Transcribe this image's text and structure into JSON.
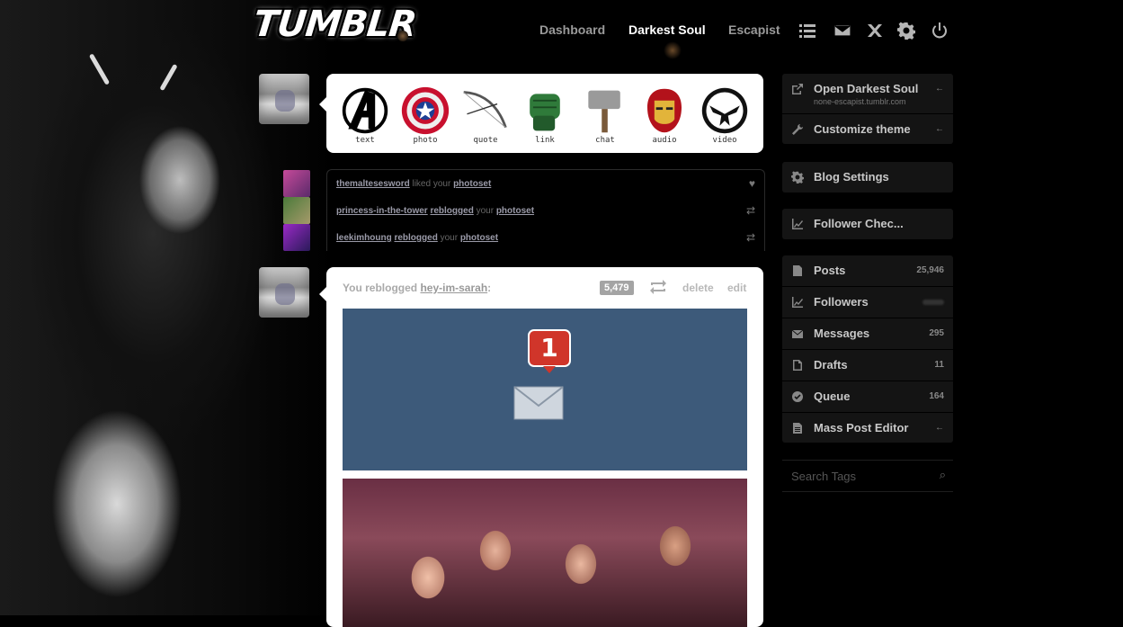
{
  "header": {
    "logo_text": "TUMBLR",
    "tabs": [
      {
        "label": "Dashboard",
        "active": false
      },
      {
        "label": "Darkest Soul",
        "active": true
      },
      {
        "label": "Escapist",
        "active": false
      }
    ],
    "icons": [
      "list-icon",
      "mail-icon",
      "x-icon",
      "gear-icon",
      "power-icon"
    ]
  },
  "composer": {
    "types": [
      {
        "label": "text",
        "icon": "avengers-icon"
      },
      {
        "label": "photo",
        "icon": "captain-shield-icon"
      },
      {
        "label": "quote",
        "icon": "bow-icon"
      },
      {
        "label": "link",
        "icon": "hulk-fist-icon"
      },
      {
        "label": "chat",
        "icon": "hammer-icon"
      },
      {
        "label": "audio",
        "icon": "ironman-icon"
      },
      {
        "label": "video",
        "icon": "shield-eagle-icon"
      }
    ]
  },
  "notifications": [
    {
      "user": "themaltesesword",
      "action": "liked your",
      "object": "photoset",
      "icon": "heart-icon"
    },
    {
      "user": "princess-in-the-tower",
      "action": "reblogged",
      "middle": "your",
      "object": "photoset",
      "icon": "reblog-icon"
    },
    {
      "user": "leekimhoung",
      "action": "reblogged",
      "middle": "your",
      "object": "photoset",
      "icon": "reblog-icon"
    }
  ],
  "post": {
    "prefix": "You reblogged",
    "source": "hey-im-sarah",
    "suffix": ":",
    "notes": "5,479",
    "delete_label": "delete",
    "edit_label": "edit",
    "badge_number": "1"
  },
  "sidebar": {
    "blog_box": {
      "open_label": "Open Darkest Soul",
      "open_url": "none-escapist.tumblr.com",
      "customize_label": "Customize theme"
    },
    "settings_label": "Blog Settings",
    "follower_check_label": "Follower Chec...",
    "stats": [
      {
        "label": "Posts",
        "count": "25,946",
        "icon": "document-icon"
      },
      {
        "label": "Followers",
        "count": "",
        "icon": "chart-icon"
      },
      {
        "label": "Messages",
        "count": "295",
        "icon": "mail-icon"
      },
      {
        "label": "Drafts",
        "count": "11",
        "icon": "draft-icon"
      },
      {
        "label": "Queue",
        "count": "164",
        "icon": "check-icon"
      },
      {
        "label": "Mass Post Editor",
        "count": "",
        "icon": "editor-icon"
      }
    ],
    "search_placeholder": "Search Tags"
  },
  "colors": {
    "background": "#000000",
    "panel": "#141414",
    "post_bg": "#ffffff",
    "image_blue": "#3d5a7a",
    "badge_red": "#d0352a"
  }
}
